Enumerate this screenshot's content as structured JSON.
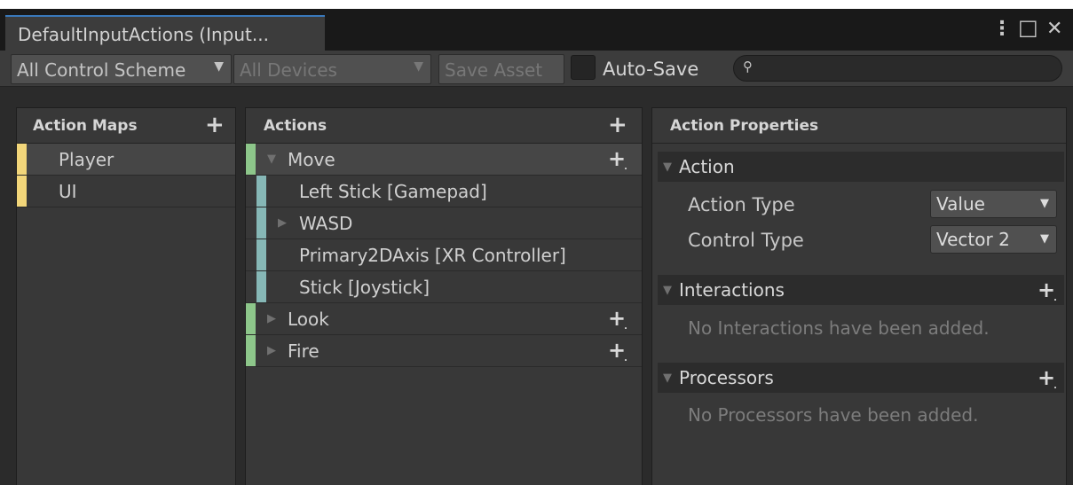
{
  "window": {
    "tab_title": "DefaultInputActions (Input...",
    "menu_icon": "⋮",
    "maximize_icon": "□",
    "close_icon": "✕"
  },
  "toolbar": {
    "control_scheme": "All Control Scheme",
    "devices": "All Devices",
    "save_asset": "Save Asset",
    "auto_save_label": "Auto-Save",
    "search_value": ""
  },
  "action_maps": {
    "title": "Action Maps",
    "items": [
      {
        "label": "Player",
        "selected": true
      },
      {
        "label": "UI",
        "selected": false
      }
    ]
  },
  "actions": {
    "title": "Actions",
    "items": [
      {
        "label": "Move",
        "kind": "action",
        "expanded": true
      },
      {
        "label": "Left Stick [Gamepad]",
        "kind": "binding"
      },
      {
        "label": "WASD",
        "kind": "composite",
        "expanded": false
      },
      {
        "label": "Primary2DAxis [XR Controller]",
        "kind": "binding"
      },
      {
        "label": "Stick [Joystick]",
        "kind": "binding"
      },
      {
        "label": "Look",
        "kind": "action",
        "expanded": false
      },
      {
        "label": "Fire",
        "kind": "action",
        "expanded": false
      }
    ]
  },
  "properties": {
    "title": "Action Properties",
    "action_section": "Action",
    "action_type_label": "Action Type",
    "action_type_value": "Value",
    "control_type_label": "Control Type",
    "control_type_value": "Vector 2",
    "interactions_section": "Interactions",
    "interactions_empty": "No Interactions have been added.",
    "processors_section": "Processors",
    "processors_empty": "No Processors have been added."
  },
  "colors": {
    "action_map_bar": "#f2d67a",
    "action_bar": "#8dc68a",
    "binding_bar": "#86b7b6",
    "tab_accent": "#3a79bb"
  }
}
